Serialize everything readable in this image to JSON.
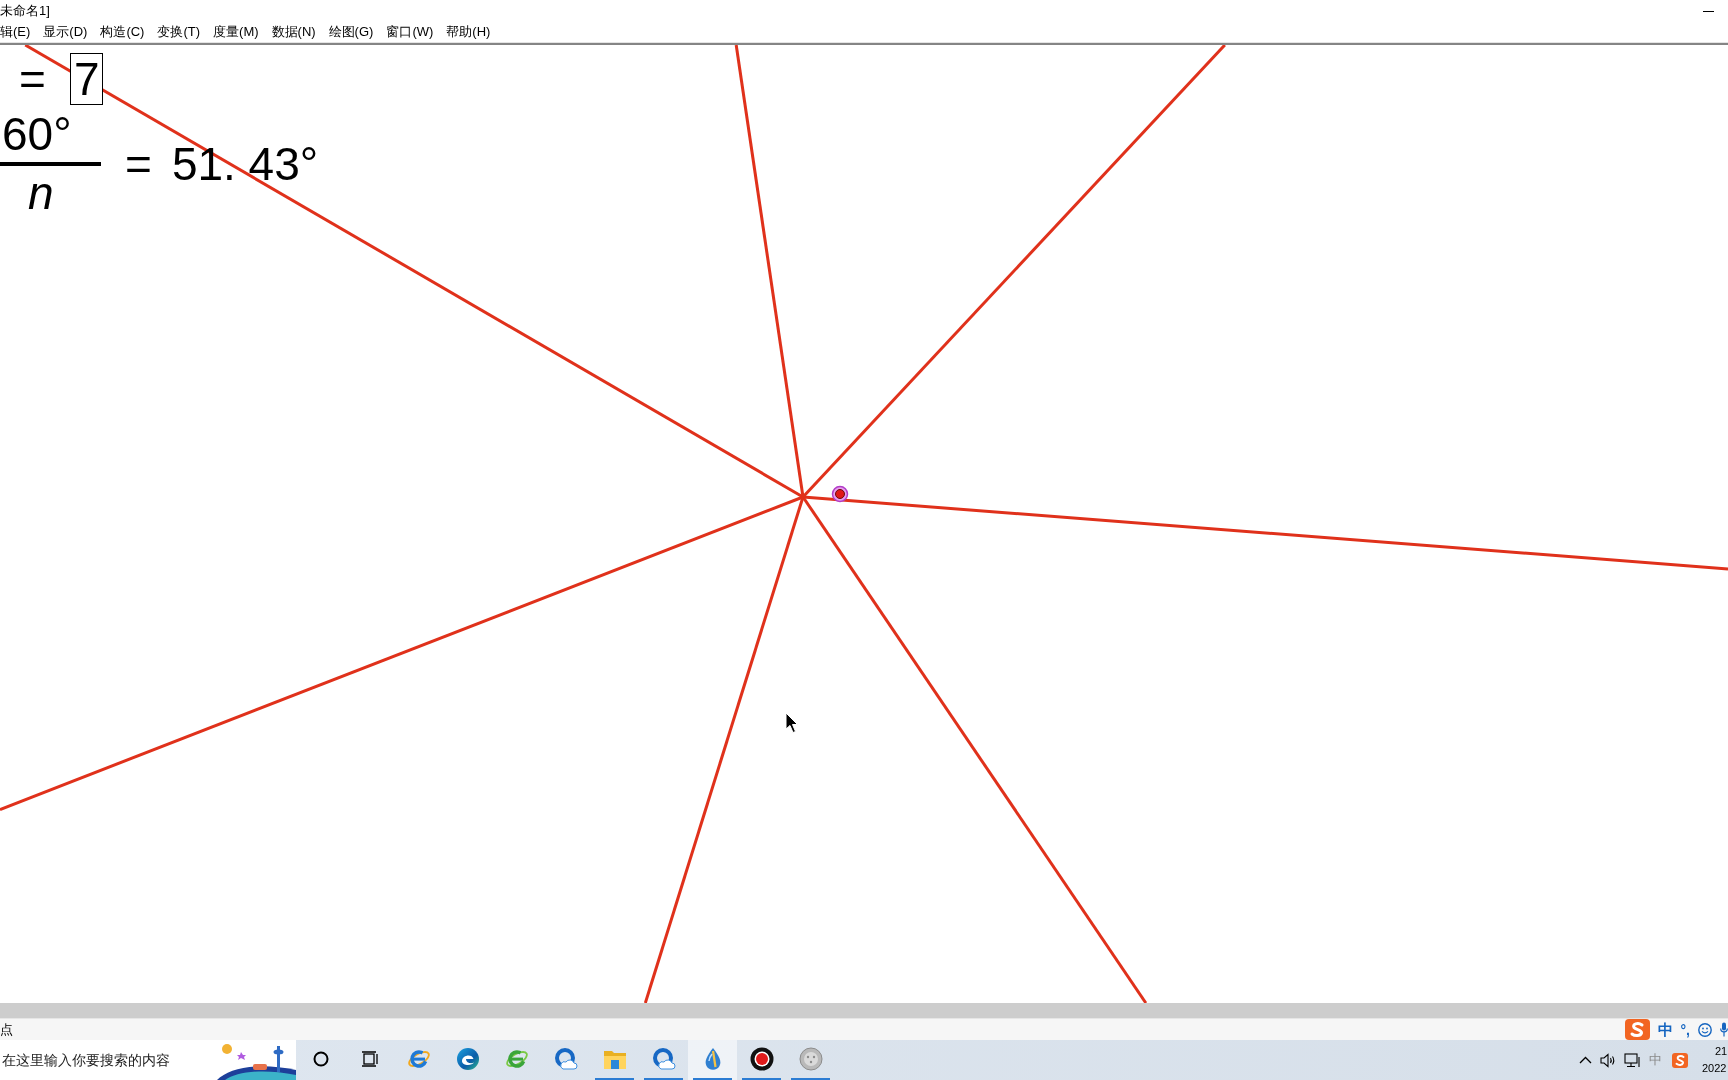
{
  "window": {
    "title": "未命名1]"
  },
  "menu_bar": {
    "items": [
      "辑(E)",
      "显示(D)",
      "构造(C)",
      "变换(T)",
      "度量(M)",
      "数据(N)",
      "绘图(G)",
      "窗口(W)",
      "帮助(H)"
    ]
  },
  "canvas": {
    "parameter": {
      "equals": "=",
      "value": "7"
    },
    "calculation": {
      "numerator": "60°",
      "denominator": "n",
      "equals": "=",
      "result": "51. 43°"
    },
    "point": {
      "selected": true
    }
  },
  "status_bar": {
    "text": "点"
  },
  "ime_toolbar": {
    "mode": "中",
    "punctuation": "°,"
  },
  "taskbar": {
    "search": {
      "placeholder": "在这里输入你要搜索的内容"
    },
    "apps": [
      {
        "kind": "ie",
        "running": false,
        "active": false
      },
      {
        "kind": "edge",
        "running": false,
        "active": false
      },
      {
        "kind": "green-e",
        "running": false,
        "active": false
      },
      {
        "kind": "cloud",
        "running": false,
        "active": false
      },
      {
        "kind": "folder",
        "running": true,
        "active": false
      },
      {
        "kind": "cloud",
        "running": true,
        "active": false
      },
      {
        "kind": "sketchpad",
        "running": true,
        "active": true
      },
      {
        "kind": "record",
        "running": true,
        "active": false
      },
      {
        "kind": "disc",
        "running": true,
        "active": false
      }
    ],
    "tray": {
      "ime": "中",
      "time": "21",
      "date": "2022"
    }
  }
}
